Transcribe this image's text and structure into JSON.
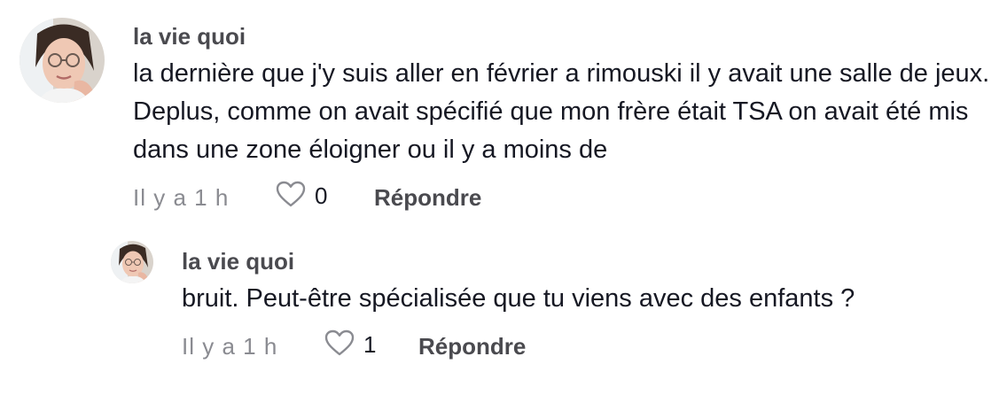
{
  "comments": [
    {
      "username": "la vie quoi",
      "text": "la dernière que j'y suis aller en février a rimouski il y avait une salle de jeux. Deplus, comme on avait spécifié que mon frère était TSA on avait été mis dans une zone éloigner ou il y a moins de",
      "time": "Il y a 1 h",
      "likes": "0",
      "reply_label": "Répondre",
      "avatar_icon": "user-avatar"
    }
  ],
  "replies": [
    {
      "username": "la vie quoi",
      "text": "bruit. Peut-être spécialisée que tu viens avec des enfants ?",
      "time": "Il y a 1 h",
      "likes": "1",
      "reply_label": "Répondre",
      "avatar_icon": "user-avatar"
    }
  ],
  "colors": {
    "username": "#4a4a4f",
    "text": "#161823",
    "meta": "#8a8b91"
  }
}
